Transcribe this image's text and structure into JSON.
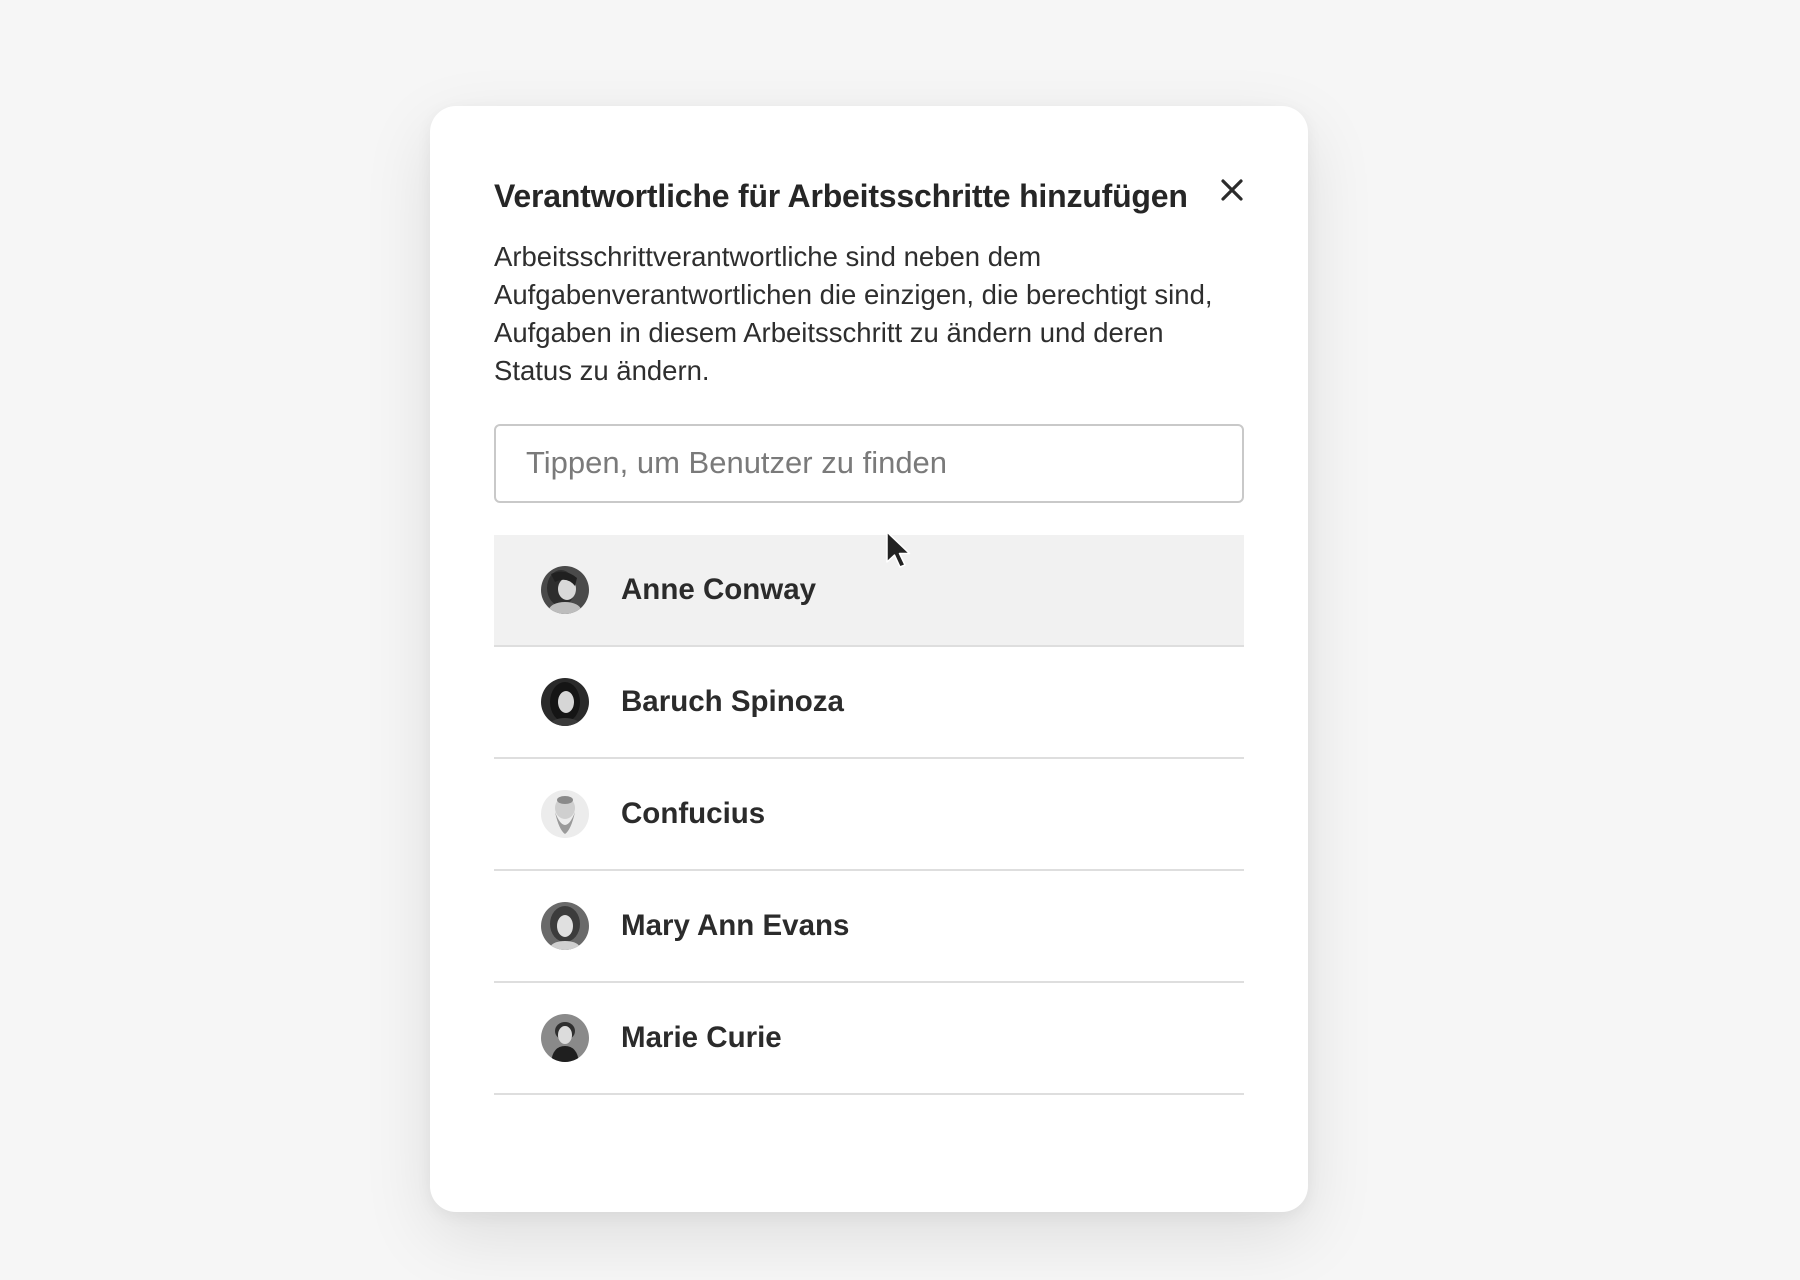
{
  "dialog": {
    "title": "Verantwortliche für Arbeitsschritte hinzufügen",
    "description": "Arbeitsschrittverantwortliche sind neben dem Aufgabenverantwortlichen die einzigen, die berechtigt sind, Aufgaben in diesem Arbeitsschritt zu ändern und deren Status zu ändern.",
    "close_icon": "close-icon"
  },
  "search": {
    "value": "",
    "placeholder": "Tippen, um Benutzer zu finden"
  },
  "users": [
    {
      "name": "Anne Conway",
      "hovered": true
    },
    {
      "name": "Baruch Spinoza",
      "hovered": false
    },
    {
      "name": "Confucius",
      "hovered": false
    },
    {
      "name": "Mary Ann Evans",
      "hovered": false
    },
    {
      "name": "Marie Curie",
      "hovered": false
    }
  ],
  "colors": {
    "background": "#f6f6f6",
    "modal": "#ffffff",
    "hover_row": "#f1f1f1",
    "divider": "#dedede",
    "text": "#2b2b2b"
  }
}
